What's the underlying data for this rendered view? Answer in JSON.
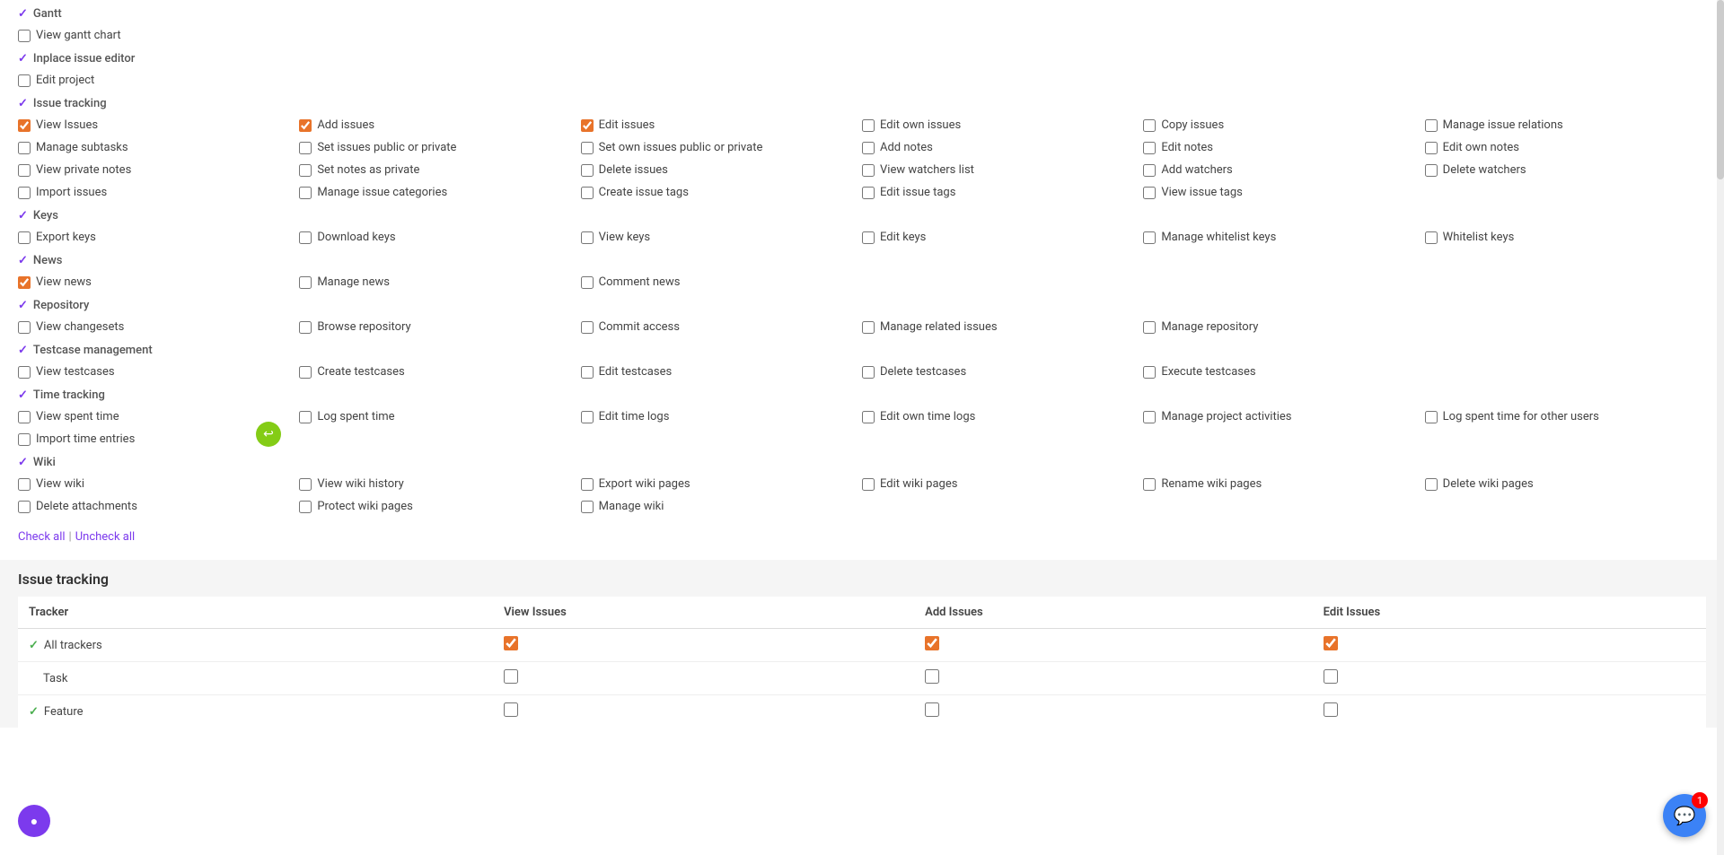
{
  "sections": [
    {
      "name": "gantt",
      "label": "Gantt",
      "checked": true,
      "permissions": [
        {
          "label": "View gantt chart",
          "checked": false
        }
      ]
    },
    {
      "name": "inplace",
      "label": "Inplace issue editor",
      "checked": true,
      "permissions": [
        {
          "label": "Edit project",
          "checked": false
        }
      ]
    },
    {
      "name": "issue_tracking",
      "label": "Issue tracking",
      "checked": true,
      "permissions_rows": [
        [
          {
            "label": "View Issues",
            "checked": true
          },
          {
            "label": "Add issues",
            "checked": true
          },
          {
            "label": "Edit issues",
            "checked": true
          },
          {
            "label": "Edit own issues",
            "checked": false
          },
          {
            "label": "Copy issues",
            "checked": false
          },
          {
            "label": "Manage issue relations",
            "checked": false
          }
        ],
        [
          {
            "label": "Manage subtasks",
            "checked": false
          },
          {
            "label": "Set issues public or private",
            "checked": false
          },
          {
            "label": "Set own issues public or private",
            "checked": false
          },
          {
            "label": "Add notes",
            "checked": false
          },
          {
            "label": "Edit notes",
            "checked": false
          },
          {
            "label": "Edit own notes",
            "checked": false
          }
        ],
        [
          {
            "label": "View private notes",
            "checked": false
          },
          {
            "label": "Set notes as private",
            "checked": false
          },
          {
            "label": "Delete issues",
            "checked": false
          },
          {
            "label": "View watchers list",
            "checked": false
          },
          {
            "label": "Add watchers",
            "checked": false
          },
          {
            "label": "Delete watchers",
            "checked": false
          }
        ],
        [
          {
            "label": "Import issues",
            "checked": false
          },
          {
            "label": "Manage issue categories",
            "checked": false
          },
          {
            "label": "Create issue tags",
            "checked": false
          },
          {
            "label": "Edit issue tags",
            "checked": false
          },
          {
            "label": "View issue tags",
            "checked": false
          },
          {
            "label": "",
            "checked": false
          }
        ]
      ]
    },
    {
      "name": "keys",
      "label": "Keys",
      "checked": true,
      "permissions_rows": [
        [
          {
            "label": "Export keys",
            "checked": false
          },
          {
            "label": "Download keys",
            "checked": false
          },
          {
            "label": "View keys",
            "checked": false
          },
          {
            "label": "Edit keys",
            "checked": false
          },
          {
            "label": "Manage whitelist keys",
            "checked": false
          },
          {
            "label": "Whitelist keys",
            "checked": false
          }
        ]
      ]
    },
    {
      "name": "news",
      "label": "News",
      "checked": true,
      "permissions_rows": [
        [
          {
            "label": "View news",
            "checked": true
          },
          {
            "label": "Manage news",
            "checked": false
          },
          {
            "label": "Comment news",
            "checked": false
          },
          {
            "label": "",
            "checked": false
          },
          {
            "label": "",
            "checked": false
          },
          {
            "label": "",
            "checked": false
          }
        ]
      ]
    },
    {
      "name": "repository",
      "label": "Repository",
      "checked": true,
      "permissions_rows": [
        [
          {
            "label": "View changesets",
            "checked": false
          },
          {
            "label": "Browse repository",
            "checked": false
          },
          {
            "label": "Commit access",
            "checked": false
          },
          {
            "label": "Manage related issues",
            "checked": false
          },
          {
            "label": "Manage repository",
            "checked": false
          },
          {
            "label": "",
            "checked": false
          }
        ]
      ]
    },
    {
      "name": "testcase",
      "label": "Testcase management",
      "checked": true,
      "permissions_rows": [
        [
          {
            "label": "View testcases",
            "checked": false
          },
          {
            "label": "Create testcases",
            "checked": false
          },
          {
            "label": "Edit testcases",
            "checked": false
          },
          {
            "label": "Delete testcases",
            "checked": false
          },
          {
            "label": "Execute testcases",
            "checked": false
          },
          {
            "label": "",
            "checked": false
          }
        ]
      ]
    },
    {
      "name": "time_tracking",
      "label": "Time tracking",
      "checked": true,
      "permissions_rows": [
        [
          {
            "label": "View spent time",
            "checked": false
          },
          {
            "label": "Log spent time",
            "checked": false
          },
          {
            "label": "Edit time logs",
            "checked": false
          },
          {
            "label": "Edit own time logs",
            "checked": false
          },
          {
            "label": "Manage project activities",
            "checked": false
          },
          {
            "label": "Log spent time for other users",
            "checked": false
          }
        ],
        [
          {
            "label": "Import time entries",
            "checked": false
          },
          {
            "label": "",
            "checked": false
          },
          {
            "label": "",
            "checked": false
          },
          {
            "label": "",
            "checked": false
          },
          {
            "label": "",
            "checked": false
          },
          {
            "label": "",
            "checked": false
          }
        ]
      ]
    },
    {
      "name": "wiki",
      "label": "Wiki",
      "checked": true,
      "permissions_rows": [
        [
          {
            "label": "View wiki",
            "checked": false
          },
          {
            "label": "View wiki history",
            "checked": false
          },
          {
            "label": "Export wiki pages",
            "checked": false
          },
          {
            "label": "Edit wiki pages",
            "checked": false
          },
          {
            "label": "Rename wiki pages",
            "checked": false
          },
          {
            "label": "Delete wiki pages",
            "checked": false
          }
        ],
        [
          {
            "label": "Delete attachments",
            "checked": false
          },
          {
            "label": "Protect wiki pages",
            "checked": false
          },
          {
            "label": "Manage wiki",
            "checked": false
          },
          {
            "label": "",
            "checked": false
          },
          {
            "label": "",
            "checked": false
          },
          {
            "label": "",
            "checked": false
          }
        ]
      ]
    }
  ],
  "check_all_label": "Check all",
  "uncheck_all_label": "Uncheck all",
  "issue_tracking_section": {
    "title": "Issue tracking",
    "columns": [
      "Tracker",
      "View Issues",
      "Add Issues",
      "Edit Issues"
    ],
    "rows": [
      {
        "name": "All trackers",
        "has_check": true,
        "view": true,
        "add": true,
        "edit": true
      },
      {
        "name": "Task",
        "has_check": false,
        "view": false,
        "add": false,
        "edit": false
      },
      {
        "name": "Feature",
        "has_check": true,
        "view": false,
        "add": false,
        "edit": false
      }
    ]
  },
  "chat_badge": "1"
}
